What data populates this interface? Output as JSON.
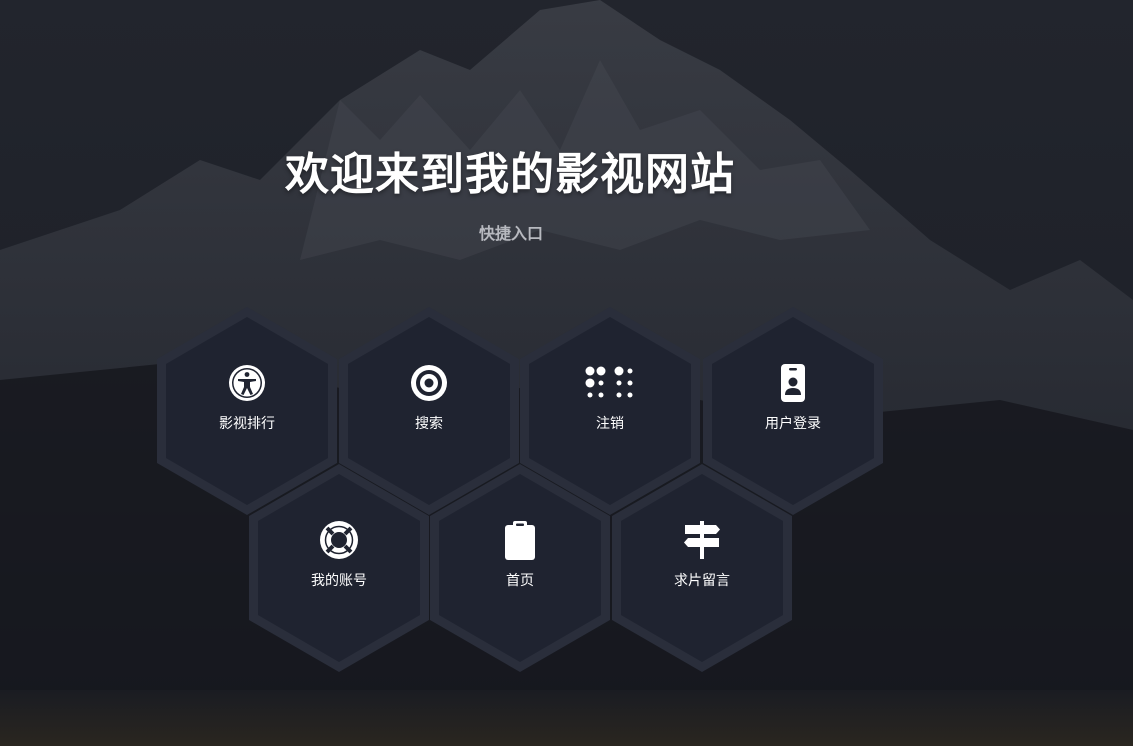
{
  "header": {
    "title": "欢迎来到我的影视网站",
    "subtitle": "快捷入口"
  },
  "tiles": [
    {
      "label": "影视排行",
      "icon": "accessibility-icon"
    },
    {
      "label": "搜索",
      "icon": "target-icon"
    },
    {
      "label": "注销",
      "icon": "braille-dots-icon"
    },
    {
      "label": "用户登录",
      "icon": "id-badge-icon"
    },
    {
      "label": "我的账号",
      "icon": "lifebuoy-icon"
    },
    {
      "label": "首页",
      "icon": "clipboard-icon"
    },
    {
      "label": "求片留言",
      "icon": "signpost-icon"
    }
  ],
  "colors": {
    "background": "#1d2029",
    "hex_border": "#2a2e3b",
    "hex_fill": "#1f2330",
    "text": "#ffffff",
    "subtitle": "#b7b9bf"
  }
}
